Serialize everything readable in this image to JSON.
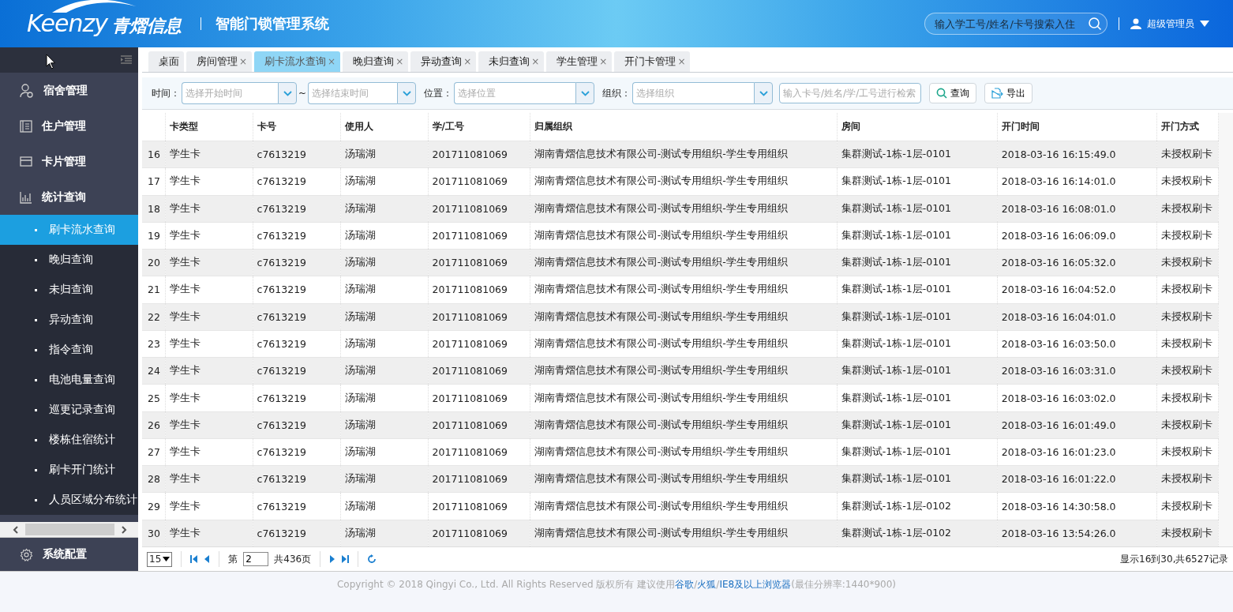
{
  "header": {
    "logo_text": "Keenzy",
    "logo_cn": "青熠信息",
    "system_title": "智能门锁管理系统",
    "search": {
      "placeholder": "输入学工号/姓名/卡号搜索入住"
    },
    "user": "超级管理员"
  },
  "sidebar": {
    "items": [
      {
        "label": "宿舍管理"
      },
      {
        "label": "住户管理"
      },
      {
        "label": "卡片管理"
      },
      {
        "label": "统计查询",
        "children": [
          {
            "label": "刷卡流水查询",
            "selected": true
          },
          {
            "label": "晚归查询",
            "selected": false
          },
          {
            "label": "未归查询",
            "selected": false
          },
          {
            "label": "异动查询",
            "selected": false
          },
          {
            "label": "指令查询",
            "selected": false
          },
          {
            "label": "电池电量查询",
            "selected": false
          },
          {
            "label": "巡更记录查询",
            "selected": false
          },
          {
            "label": "楼栋住宿统计",
            "selected": false
          },
          {
            "label": "刷卡开门统计",
            "selected": false
          },
          {
            "label": "人员区域分布统计",
            "selected": false
          }
        ]
      }
    ],
    "bottom_item": {
      "label": "系统配置"
    }
  },
  "tabs": [
    {
      "label": "桌面",
      "selected": false,
      "closable": false
    },
    {
      "label": "房间管理",
      "selected": false,
      "closable": true
    },
    {
      "label": "刷卡流水查询",
      "selected": true,
      "closable": true
    },
    {
      "label": "晚归查询",
      "selected": false,
      "closable": true
    },
    {
      "label": "异动查询",
      "selected": false,
      "closable": true
    },
    {
      "label": "未归查询",
      "selected": false,
      "closable": true
    },
    {
      "label": "学生管理",
      "selected": false,
      "closable": true
    },
    {
      "label": "开门卡管理",
      "selected": false,
      "closable": true
    }
  ],
  "close_mark": "×",
  "filters": {
    "time_label": "时间：",
    "start_placeholder": "选择开始时间",
    "range_sep": "~",
    "end_placeholder": "选择结束时间",
    "location_label": "位置：",
    "location_placeholder": "选择位置",
    "org_label": "组织：",
    "org_placeholder": "选择组织",
    "keyword_placeholder": "输入卡号/姓名/学/工号进行检索",
    "query_button": "查询",
    "export_button": "导出"
  },
  "table": {
    "columns": [
      "",
      "卡类型",
      "卡号",
      "使用人",
      "学/工号",
      "归属组织",
      "房间",
      "开门时间",
      "开门方式"
    ],
    "rows": [
      [
        "16",
        "学生卡",
        "c7613219",
        "汤瑞湖",
        "201711081069",
        "湖南青熠信息技术有限公司-测试专用组织-学生专用组织",
        "集群测试-1栋-1层-0101",
        "2018-03-16 16:15:49.0",
        "未授权刷卡"
      ],
      [
        "17",
        "学生卡",
        "c7613219",
        "汤瑞湖",
        "201711081069",
        "湖南青熠信息技术有限公司-测试专用组织-学生专用组织",
        "集群测试-1栋-1层-0101",
        "2018-03-16 16:14:01.0",
        "未授权刷卡"
      ],
      [
        "18",
        "学生卡",
        "c7613219",
        "汤瑞湖",
        "201711081069",
        "湖南青熠信息技术有限公司-测试专用组织-学生专用组织",
        "集群测试-1栋-1层-0101",
        "2018-03-16 16:08:01.0",
        "未授权刷卡"
      ],
      [
        "19",
        "学生卡",
        "c7613219",
        "汤瑞湖",
        "201711081069",
        "湖南青熠信息技术有限公司-测试专用组织-学生专用组织",
        "集群测试-1栋-1层-0101",
        "2018-03-16 16:06:09.0",
        "未授权刷卡"
      ],
      [
        "20",
        "学生卡",
        "c7613219",
        "汤瑞湖",
        "201711081069",
        "湖南青熠信息技术有限公司-测试专用组织-学生专用组织",
        "集群测试-1栋-1层-0101",
        "2018-03-16 16:05:32.0",
        "未授权刷卡"
      ],
      [
        "21",
        "学生卡",
        "c7613219",
        "汤瑞湖",
        "201711081069",
        "湖南青熠信息技术有限公司-测试专用组织-学生专用组织",
        "集群测试-1栋-1层-0101",
        "2018-03-16 16:04:52.0",
        "未授权刷卡"
      ],
      [
        "22",
        "学生卡",
        "c7613219",
        "汤瑞湖",
        "201711081069",
        "湖南青熠信息技术有限公司-测试专用组织-学生专用组织",
        "集群测试-1栋-1层-0101",
        "2018-03-16 16:04:01.0",
        "未授权刷卡"
      ],
      [
        "23",
        "学生卡",
        "c7613219",
        "汤瑞湖",
        "201711081069",
        "湖南青熠信息技术有限公司-测试专用组织-学生专用组织",
        "集群测试-1栋-1层-0101",
        "2018-03-16 16:03:50.0",
        "未授权刷卡"
      ],
      [
        "24",
        "学生卡",
        "c7613219",
        "汤瑞湖",
        "201711081069",
        "湖南青熠信息技术有限公司-测试专用组织-学生专用组织",
        "集群测试-1栋-1层-0101",
        "2018-03-16 16:03:31.0",
        "未授权刷卡"
      ],
      [
        "25",
        "学生卡",
        "c7613219",
        "汤瑞湖",
        "201711081069",
        "湖南青熠信息技术有限公司-测试专用组织-学生专用组织",
        "集群测试-1栋-1层-0101",
        "2018-03-16 16:03:02.0",
        "未授权刷卡"
      ],
      [
        "26",
        "学生卡",
        "c7613219",
        "汤瑞湖",
        "201711081069",
        "湖南青熠信息技术有限公司-测试专用组织-学生专用组织",
        "集群测试-1栋-1层-0101",
        "2018-03-16 16:01:49.0",
        "未授权刷卡"
      ],
      [
        "27",
        "学生卡",
        "c7613219",
        "汤瑞湖",
        "201711081069",
        "湖南青熠信息技术有限公司-测试专用组织-学生专用组织",
        "集群测试-1栋-1层-0101",
        "2018-03-16 16:01:23.0",
        "未授权刷卡"
      ],
      [
        "28",
        "学生卡",
        "c7613219",
        "汤瑞湖",
        "201711081069",
        "湖南青熠信息技术有限公司-测试专用组织-学生专用组织",
        "集群测试-1栋-1层-0101",
        "2018-03-16 16:01:22.0",
        "未授权刷卡"
      ],
      [
        "29",
        "学生卡",
        "c7613219",
        "汤瑞湖",
        "201711081069",
        "湖南青熠信息技术有限公司-测试专用组织-学生专用组织",
        "集群测试-1栋-1层-0102",
        "2018-03-16 14:30:58.0",
        "未授权刷卡"
      ],
      [
        "30",
        "学生卡",
        "c7613219",
        "汤瑞湖",
        "201711081069",
        "湖南青熠信息技术有限公司-测试专用组织-学生专用组织",
        "集群测试-1栋-1层-0102",
        "2018-03-16 13:54:26.0",
        "未授权刷卡"
      ]
    ]
  },
  "pager": {
    "page_size": "15",
    "page_prefix": "第",
    "page": "2",
    "page_total": "共436页",
    "summary": "显示16到30,共6527记录"
  },
  "footer": {
    "copyright": "Copyright © 2018 Qingyi Co., Ltd. All Rights Reserved 版权所有 建议使用",
    "links": [
      "谷歌",
      "火狐",
      "IE8及以上浏览器"
    ],
    "separator": "/",
    "note": "(最佳分辨率:1440*900)"
  }
}
